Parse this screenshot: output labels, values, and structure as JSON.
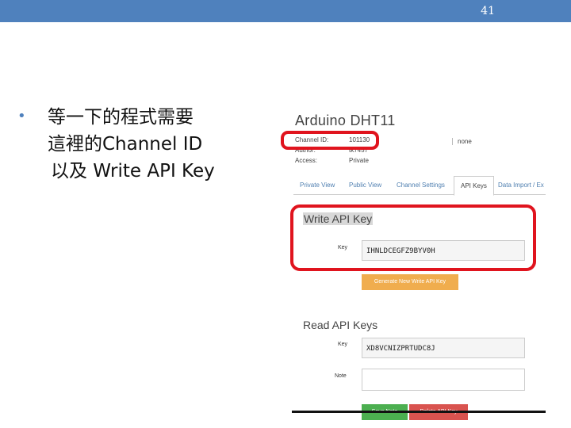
{
  "slide": {
    "page_number": "41",
    "bullet_lines": [
      "等一下的程式需要",
      "這裡的Channel ID",
      "以及 Write API Key"
    ]
  },
  "channel": {
    "title": "Arduino DHT11",
    "channel_id_label": "Channel ID:",
    "channel_id_value": "101130",
    "author_label": "Author:",
    "author_value": "tk7457",
    "access_label": "Access:",
    "access_value": "Private",
    "right_value": "none"
  },
  "tabs": [
    "Private View",
    "Public View",
    "Channel Settings",
    "API Keys",
    "Data Import / Ex"
  ],
  "write_key": {
    "title": "Write API Key",
    "key_label": "Key",
    "key_value": "IHNLDCEGFZ9BYV0H",
    "generate_button": "Generate New Write API Key"
  },
  "read_keys": {
    "title": "Read API Keys",
    "key_label": "Key",
    "key_value": "XD8VCNIZPRTUDC8J",
    "note_label": "Note",
    "note_value": "",
    "save_button": "Save Note",
    "delete_button": "Delete API Key"
  },
  "colors": {
    "topbar": "#4f81bd",
    "highlight": "#e0141e",
    "generate": "#f0ad4e",
    "save": "#4caf50",
    "delete": "#d9534f"
  }
}
